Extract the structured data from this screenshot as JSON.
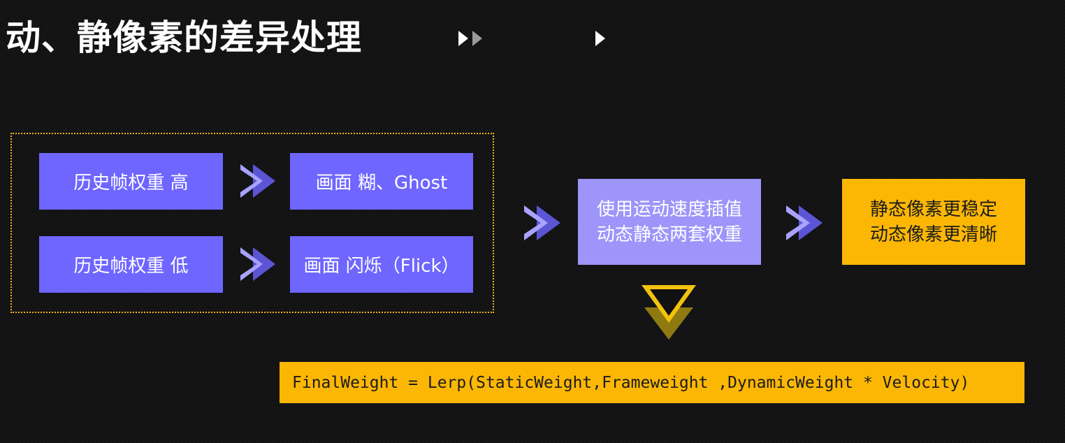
{
  "title": "动、静像素的差异处理",
  "left_group": {
    "high_weight": "历史帧权重 高",
    "blur": "画面 糊、Ghost",
    "low_weight": "历史帧权重 低",
    "flicker": "画面 闪烁（Flick）"
  },
  "middle": {
    "line1": "使用运动速度插值",
    "line2": "动态静态两套权重"
  },
  "result": {
    "line1": "静态像素更稳定",
    "line2": "动态像素更清晰"
  },
  "formula": "FinalWeight = Lerp(StaticWeight,Frameweight ,DynamicWeight * Velocity)",
  "colors": {
    "purple": "#6e66ff",
    "light_purple": "#9d95fa",
    "yellow": "#fcb705",
    "frame_border": "#f2b618"
  },
  "icons": [
    "play-icon",
    "double-chevron-right-icon",
    "double-chevron-down-icon"
  ]
}
